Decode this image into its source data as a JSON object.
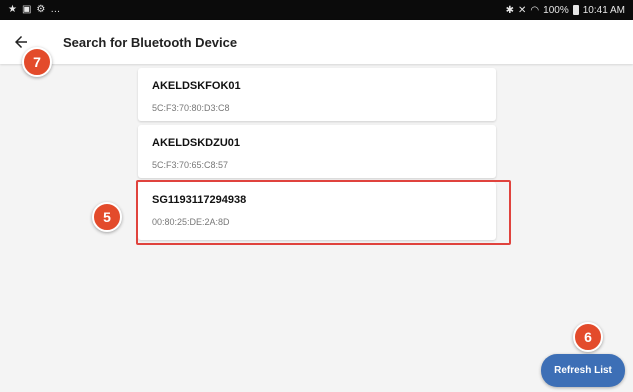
{
  "status_bar": {
    "left_icons": [
      "star-icon",
      "image-icon",
      "settings-icon",
      "more-icon"
    ],
    "right_text": "100%",
    "time": "10:41 AM"
  },
  "app_bar": {
    "title": "Search for Bluetooth Device"
  },
  "devices": [
    {
      "name": "AKELDSKFOK01",
      "address": "5C:F3:70:80:D3:C8"
    },
    {
      "name": "AKELDSKDZU01",
      "address": "5C:F3:70:65:C8:57"
    },
    {
      "name": "SG1193117294938",
      "address": "00:80:25:DE:2A:8D"
    }
  ],
  "annotations": {
    "badge_5": "5",
    "badge_6": "6",
    "badge_7": "7"
  },
  "refresh_label": "Refresh List",
  "colors": {
    "accent_button": "#3d6fb6",
    "badge": "#e34b2b",
    "highlight": "#e0433d",
    "status_bar": "#0b0b0b"
  }
}
